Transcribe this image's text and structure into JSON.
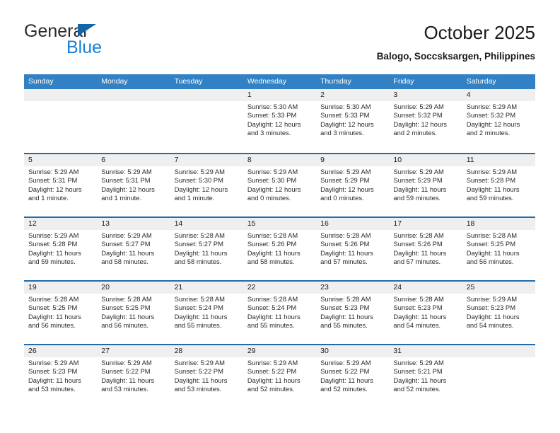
{
  "brand": {
    "name_part1": "General",
    "name_part2": "Blue",
    "triangle_color": "#1565a8",
    "blue_color": "#1b7fd4"
  },
  "header": {
    "title": "October 2025",
    "subtitle": "Balogo, Soccsksargen, Philippines"
  },
  "theme": {
    "header_bar": "#3281c4",
    "row_divider": "#1f6cb0",
    "day_strip": "#efefef"
  },
  "weekdays": [
    "Sunday",
    "Monday",
    "Tuesday",
    "Wednesday",
    "Thursday",
    "Friday",
    "Saturday"
  ],
  "weeks": [
    [
      {
        "day": "",
        "sunrise": "",
        "sunset": "",
        "daylight": "",
        "empty": true
      },
      {
        "day": "",
        "sunrise": "",
        "sunset": "",
        "daylight": "",
        "empty": true
      },
      {
        "day": "",
        "sunrise": "",
        "sunset": "",
        "daylight": "",
        "empty": true
      },
      {
        "day": "1",
        "sunrise": "Sunrise: 5:30 AM",
        "sunset": "Sunset: 5:33 PM",
        "daylight": "Daylight: 12 hours and 3 minutes."
      },
      {
        "day": "2",
        "sunrise": "Sunrise: 5:30 AM",
        "sunset": "Sunset: 5:33 PM",
        "daylight": "Daylight: 12 hours and 3 minutes."
      },
      {
        "day": "3",
        "sunrise": "Sunrise: 5:29 AM",
        "sunset": "Sunset: 5:32 PM",
        "daylight": "Daylight: 12 hours and 2 minutes."
      },
      {
        "day": "4",
        "sunrise": "Sunrise: 5:29 AM",
        "sunset": "Sunset: 5:32 PM",
        "daylight": "Daylight: 12 hours and 2 minutes."
      }
    ],
    [
      {
        "day": "5",
        "sunrise": "Sunrise: 5:29 AM",
        "sunset": "Sunset: 5:31 PM",
        "daylight": "Daylight: 12 hours and 1 minute."
      },
      {
        "day": "6",
        "sunrise": "Sunrise: 5:29 AM",
        "sunset": "Sunset: 5:31 PM",
        "daylight": "Daylight: 12 hours and 1 minute."
      },
      {
        "day": "7",
        "sunrise": "Sunrise: 5:29 AM",
        "sunset": "Sunset: 5:30 PM",
        "daylight": "Daylight: 12 hours and 1 minute."
      },
      {
        "day": "8",
        "sunrise": "Sunrise: 5:29 AM",
        "sunset": "Sunset: 5:30 PM",
        "daylight": "Daylight: 12 hours and 0 minutes."
      },
      {
        "day": "9",
        "sunrise": "Sunrise: 5:29 AM",
        "sunset": "Sunset: 5:29 PM",
        "daylight": "Daylight: 12 hours and 0 minutes."
      },
      {
        "day": "10",
        "sunrise": "Sunrise: 5:29 AM",
        "sunset": "Sunset: 5:29 PM",
        "daylight": "Daylight: 11 hours and 59 minutes."
      },
      {
        "day": "11",
        "sunrise": "Sunrise: 5:29 AM",
        "sunset": "Sunset: 5:28 PM",
        "daylight": "Daylight: 11 hours and 59 minutes."
      }
    ],
    [
      {
        "day": "12",
        "sunrise": "Sunrise: 5:29 AM",
        "sunset": "Sunset: 5:28 PM",
        "daylight": "Daylight: 11 hours and 59 minutes."
      },
      {
        "day": "13",
        "sunrise": "Sunrise: 5:29 AM",
        "sunset": "Sunset: 5:27 PM",
        "daylight": "Daylight: 11 hours and 58 minutes."
      },
      {
        "day": "14",
        "sunrise": "Sunrise: 5:28 AM",
        "sunset": "Sunset: 5:27 PM",
        "daylight": "Daylight: 11 hours and 58 minutes."
      },
      {
        "day": "15",
        "sunrise": "Sunrise: 5:28 AM",
        "sunset": "Sunset: 5:26 PM",
        "daylight": "Daylight: 11 hours and 58 minutes."
      },
      {
        "day": "16",
        "sunrise": "Sunrise: 5:28 AM",
        "sunset": "Sunset: 5:26 PM",
        "daylight": "Daylight: 11 hours and 57 minutes."
      },
      {
        "day": "17",
        "sunrise": "Sunrise: 5:28 AM",
        "sunset": "Sunset: 5:26 PM",
        "daylight": "Daylight: 11 hours and 57 minutes."
      },
      {
        "day": "18",
        "sunrise": "Sunrise: 5:28 AM",
        "sunset": "Sunset: 5:25 PM",
        "daylight": "Daylight: 11 hours and 56 minutes."
      }
    ],
    [
      {
        "day": "19",
        "sunrise": "Sunrise: 5:28 AM",
        "sunset": "Sunset: 5:25 PM",
        "daylight": "Daylight: 11 hours and 56 minutes."
      },
      {
        "day": "20",
        "sunrise": "Sunrise: 5:28 AM",
        "sunset": "Sunset: 5:25 PM",
        "daylight": "Daylight: 11 hours and 56 minutes."
      },
      {
        "day": "21",
        "sunrise": "Sunrise: 5:28 AM",
        "sunset": "Sunset: 5:24 PM",
        "daylight": "Daylight: 11 hours and 55 minutes."
      },
      {
        "day": "22",
        "sunrise": "Sunrise: 5:28 AM",
        "sunset": "Sunset: 5:24 PM",
        "daylight": "Daylight: 11 hours and 55 minutes."
      },
      {
        "day": "23",
        "sunrise": "Sunrise: 5:28 AM",
        "sunset": "Sunset: 5:23 PM",
        "daylight": "Daylight: 11 hours and 55 minutes."
      },
      {
        "day": "24",
        "sunrise": "Sunrise: 5:28 AM",
        "sunset": "Sunset: 5:23 PM",
        "daylight": "Daylight: 11 hours and 54 minutes."
      },
      {
        "day": "25",
        "sunrise": "Sunrise: 5:29 AM",
        "sunset": "Sunset: 5:23 PM",
        "daylight": "Daylight: 11 hours and 54 minutes."
      }
    ],
    [
      {
        "day": "26",
        "sunrise": "Sunrise: 5:29 AM",
        "sunset": "Sunset: 5:23 PM",
        "daylight": "Daylight: 11 hours and 53 minutes."
      },
      {
        "day": "27",
        "sunrise": "Sunrise: 5:29 AM",
        "sunset": "Sunset: 5:22 PM",
        "daylight": "Daylight: 11 hours and 53 minutes."
      },
      {
        "day": "28",
        "sunrise": "Sunrise: 5:29 AM",
        "sunset": "Sunset: 5:22 PM",
        "daylight": "Daylight: 11 hours and 53 minutes."
      },
      {
        "day": "29",
        "sunrise": "Sunrise: 5:29 AM",
        "sunset": "Sunset: 5:22 PM",
        "daylight": "Daylight: 11 hours and 52 minutes."
      },
      {
        "day": "30",
        "sunrise": "Sunrise: 5:29 AM",
        "sunset": "Sunset: 5:22 PM",
        "daylight": "Daylight: 11 hours and 52 minutes."
      },
      {
        "day": "31",
        "sunrise": "Sunrise: 5:29 AM",
        "sunset": "Sunset: 5:21 PM",
        "daylight": "Daylight: 11 hours and 52 minutes."
      },
      {
        "day": "",
        "sunrise": "",
        "sunset": "",
        "daylight": "",
        "empty": true
      }
    ]
  ]
}
